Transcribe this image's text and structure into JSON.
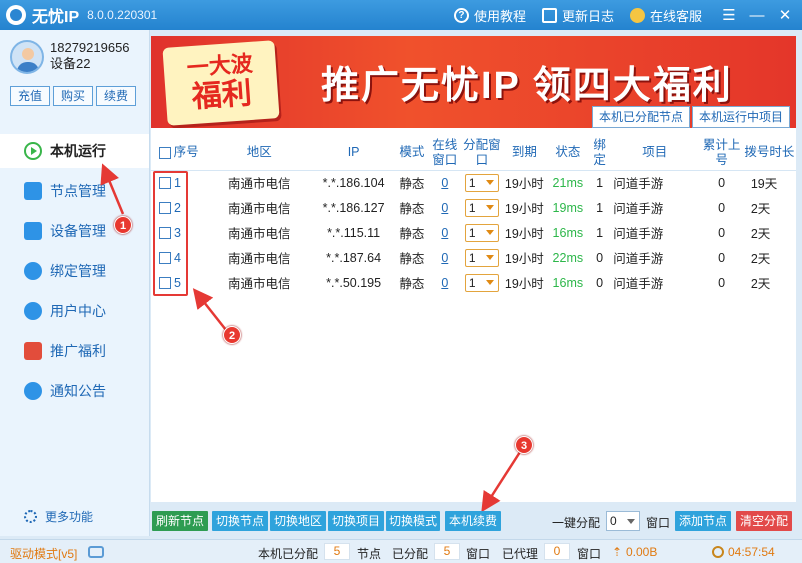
{
  "app": {
    "name": "无忧IP",
    "version": "8.0.0.220301"
  },
  "titlebar": {
    "tutorial": "使用教程",
    "changelog": "更新日志",
    "support": "在线客服"
  },
  "user": {
    "phone": "18279219656",
    "device": "设备22",
    "buttons": [
      "充值",
      "购买",
      "续费"
    ]
  },
  "sidebar": {
    "items": [
      {
        "label": "本机运行",
        "active": true
      },
      {
        "label": "节点管理"
      },
      {
        "label": "设备管理"
      },
      {
        "label": "绑定管理"
      },
      {
        "label": "用户中心"
      },
      {
        "label": "推广福利"
      },
      {
        "label": "通知公告"
      }
    ],
    "more": "更多功能"
  },
  "banner": {
    "left_line1": "一大波",
    "left_line2": "福利",
    "headline": "推广无忧IP  领四大福利",
    "tabs": [
      "本机已分配节点",
      "本机运行中项目"
    ]
  },
  "table": {
    "headers": [
      "序号",
      "地区",
      "IP",
      "模式",
      "在线窗口",
      "分配窗口",
      "到期",
      "状态",
      "绑定",
      "项目",
      "累计上号",
      "拨号时长"
    ],
    "rows": [
      {
        "no": "1",
        "region": "南通市电信",
        "ip": "*.*.186.104",
        "mode": "静态",
        "online": "0",
        "assign": "1",
        "expire": "19小时",
        "status": "21ms",
        "bind": "1",
        "project": "问道手游",
        "total": "0",
        "duration": "19天"
      },
      {
        "no": "2",
        "region": "南通市电信",
        "ip": "*.*.186.127",
        "mode": "静态",
        "online": "0",
        "assign": "1",
        "expire": "19小时",
        "status": "19ms",
        "bind": "1",
        "project": "问道手游",
        "total": "0",
        "duration": "2天"
      },
      {
        "no": "3",
        "region": "南通市电信",
        "ip": "*.*.115.11",
        "mode": "静态",
        "online": "0",
        "assign": "1",
        "expire": "19小时",
        "status": "16ms",
        "bind": "1",
        "project": "问道手游",
        "total": "0",
        "duration": "2天"
      },
      {
        "no": "4",
        "region": "南通市电信",
        "ip": "*.*.187.64",
        "mode": "静态",
        "online": "0",
        "assign": "1",
        "expire": "19小时",
        "status": "22ms",
        "bind": "0",
        "project": "问道手游",
        "total": "0",
        "duration": "2天"
      },
      {
        "no": "5",
        "region": "南通市电信",
        "ip": "*.*.50.195",
        "mode": "静态",
        "online": "0",
        "assign": "1",
        "expire": "19小时",
        "status": "16ms",
        "bind": "0",
        "project": "问道手游",
        "total": "0",
        "duration": "2天"
      }
    ]
  },
  "annotations": [
    "1",
    "2",
    "3"
  ],
  "actions": {
    "refresh": "刷新节点",
    "switch_node": "切换节点",
    "switch_region": "切换地区",
    "switch_project": "切换项目",
    "switch_mode": "切换模式",
    "renew": "本机续费",
    "one_click": "一键分配",
    "one_click_value": "0",
    "window": "窗口",
    "add_node": "添加节点",
    "clear": "清空分配"
  },
  "status": {
    "driver": "驱动模式[v5]",
    "assigned_label": "本机已分配",
    "assigned_value": "5",
    "node_label": "节点",
    "allocated_label": "已分配",
    "allocated_value": "5",
    "window_label1": "窗口",
    "proxied_label": "已代理",
    "proxied_value": "0",
    "window_label2": "窗口",
    "traffic": "0.00B",
    "time": "04:57:54"
  },
  "colors": {
    "accent": "#2483cf",
    "green": "#2db74a",
    "annotation": "#e53935"
  }
}
